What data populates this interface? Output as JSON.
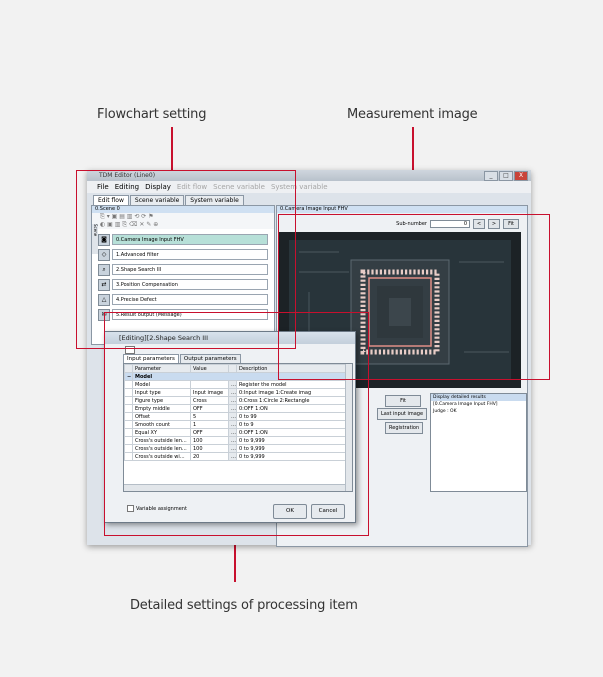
{
  "callouts": {
    "flowchart": "Flowchart setting",
    "measurement": "Measurement image",
    "detailed": "Detailed settings of processing item"
  },
  "window": {
    "title": "TDM Editor (Line0)",
    "controls": [
      "_",
      "□",
      "X"
    ]
  },
  "menu": [
    {
      "label": "File",
      "enabled": true
    },
    {
      "label": "Editing",
      "enabled": true
    },
    {
      "label": "Display",
      "enabled": true
    },
    {
      "label": "Edit flow",
      "enabled": false
    },
    {
      "label": "Scene variable",
      "enabled": false
    },
    {
      "label": "System variable",
      "enabled": false
    }
  ],
  "tabs": [
    "Edit flow",
    "Scene variable",
    "System variable"
  ],
  "left_pane": {
    "scene_header": "0.Scene 0",
    "scene_tab": "Scene",
    "flow_items": [
      "0.Camera Image Input FHV",
      "1.Advanced filter",
      "2.Shape Search III",
      "3.Position Compensation",
      "4.Precise Defect",
      "5.Result output (Message)"
    ]
  },
  "right_pane": {
    "header": "0.Camera Image Input FHV",
    "sub_number_label": "Sub-number",
    "sub_number_value": "0",
    "buttons": {
      "fit": "Fit",
      "last_input": "Last input image",
      "registration": "Registration",
      "prev": "<",
      "next": ">",
      "fit_small": "Fit"
    },
    "results_dropdown": "Display detailed results",
    "results_lines": [
      "[0.Camera Image Input FHV]",
      "Judge : OK"
    ]
  },
  "dialog": {
    "title": "[Editing][2.Shape Search III",
    "tabs": [
      "Input parameters",
      "Output parameters"
    ],
    "columns": [
      "Parameter",
      "Value",
      "Description"
    ],
    "group": "Model",
    "rows": [
      {
        "param": "Model",
        "value": "",
        "desc": "Register the model"
      },
      {
        "param": "Input type",
        "value": "Input image",
        "desc": "0:Input image 1:Create imag"
      },
      {
        "param": "Figure type",
        "value": "Cross",
        "desc": "0:Cross 1:Circle 2:Rectangle"
      },
      {
        "param": "Empty middle",
        "value": "OFF",
        "desc": "0:OFF 1:ON"
      },
      {
        "param": "Offset",
        "value": "5",
        "desc": "0 to 99"
      },
      {
        "param": "Smooth count",
        "value": "1",
        "desc": "0 to 9"
      },
      {
        "param": "Equal XY",
        "value": "OFF",
        "desc": "0:OFF 1:ON"
      },
      {
        "param": "Cross's outside len...",
        "value": "100",
        "desc": "0 to 9,999"
      },
      {
        "param": "Cross's outside len...",
        "value": "100",
        "desc": "0 to 9,999"
      },
      {
        "param": "Cross's outside wi...",
        "value": "20",
        "desc": "0 to 9,999"
      }
    ],
    "variable_assignment": "Variable assignment",
    "ok": "OK",
    "cancel": "Cancel"
  }
}
